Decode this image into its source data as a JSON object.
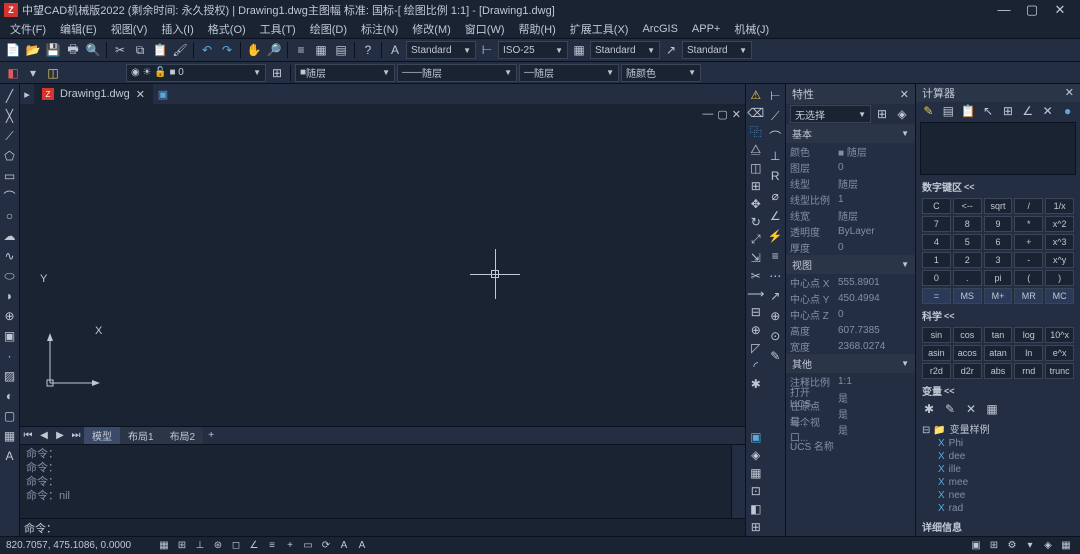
{
  "titlebar": {
    "app_icon": "Z",
    "title": "中望CAD机械版2022 (剩余时间: 永久授权) | Drawing1.dwg主图幅   标准: 国标-[ 绘图比例 1:1] - [Drawing1.dwg]"
  },
  "menu": {
    "file": "文件(F)",
    "edit": "编辑(E)",
    "view": "视图(V)",
    "insert": "插入(I)",
    "format": "格式(O)",
    "tools": "工具(T)",
    "draw": "绘图(D)",
    "dimension": "标注(N)",
    "modify": "修改(M)",
    "window": "窗口(W)",
    "help": "帮助(H)",
    "ext": "扩展工具(X)",
    "arcgis": "ArcGIS",
    "app": "APP+",
    "mech": "机械(J)"
  },
  "toolbar1": {
    "style1": "Standard",
    "style2": "ISO-25",
    "style3": "Standard",
    "style4": "Standard"
  },
  "layer_row": {
    "layer": "随层",
    "linetype": "随层",
    "lineweight": "随层",
    "color": "随颜色"
  },
  "file_tab": {
    "name": "Drawing1.dwg"
  },
  "model_tabs": {
    "model": "模型",
    "layout1": "布局1",
    "layout2": "布局2"
  },
  "command": {
    "line1": "命令：",
    "line2": "命令：",
    "line3": "命令：",
    "line4": "命令：nil",
    "prompt": "命令："
  },
  "ucs": {
    "x": "X",
    "y": "Y"
  },
  "props": {
    "title": "特性",
    "selector": "无选择",
    "section_basic": "基本",
    "color_l": "颜色",
    "color_v": "■ 随层",
    "layer_l": "图层",
    "layer_v": "0",
    "ltype_l": "线型",
    "ltype_v": "随层",
    "lscale_l": "线型比例",
    "lscale_v": "1",
    "lweight_l": "线宽",
    "lweight_v": "随层",
    "trans_l": "透明度",
    "trans_v": "ByLayer",
    "thick_l": "厚度",
    "thick_v": "0",
    "section_view": "视图",
    "cx_l": "中心点 X",
    "cx_v": "555.8901",
    "cy_l": "中心点 Y",
    "cy_v": "450.4994",
    "cz_l": "中心点 Z",
    "cz_v": "0",
    "h_l": "高度",
    "h_v": "607.7385",
    "w_l": "宽度",
    "w_v": "2368.0274",
    "section_other": "其他",
    "anno_l": "注释比例",
    "anno_v": "1:1",
    "ucs1_l": "打开 UCS...",
    "ucs1_v": "是",
    "ucs2_l": "在原点显...",
    "ucs2_v": "是",
    "ucs3_l": "每个视口...",
    "ucs3_v": "是",
    "ucs4_l": "UCS 名称",
    "ucs4_v": ""
  },
  "calc": {
    "title": "计算器",
    "numpad_title": "数字键区",
    "sci_title": "科学",
    "var_title": "变量",
    "var_folder": "变量样例",
    "vars": [
      "Phi",
      "dee",
      "ille",
      "mee",
      "nee",
      "rad"
    ],
    "detail_title": "详细信息",
    "buttons_row1": [
      "C",
      "<--",
      "sqrt",
      "/",
      "1/x"
    ],
    "buttons_row2": [
      "7",
      "8",
      "9",
      "*",
      "x^2"
    ],
    "buttons_row3": [
      "4",
      "5",
      "6",
      "+",
      "x^3"
    ],
    "buttons_row4": [
      "1",
      "2",
      "3",
      "-",
      "x^y"
    ],
    "buttons_row5": [
      "0",
      ".",
      "pi",
      "(",
      ")"
    ],
    "buttons_row6": [
      "=",
      "MS",
      "M+",
      "MR",
      "MC"
    ],
    "sci_row1": [
      "sin",
      "cos",
      "tan",
      "log",
      "10^x"
    ],
    "sci_row2": [
      "asin",
      "acos",
      "atan",
      "ln",
      "e^x"
    ],
    "sci_row3": [
      "r2d",
      "d2r",
      "abs",
      "rnd",
      "trunc"
    ]
  },
  "statusbar": {
    "coords": "820.7057, 475.1086, 0.0000"
  }
}
